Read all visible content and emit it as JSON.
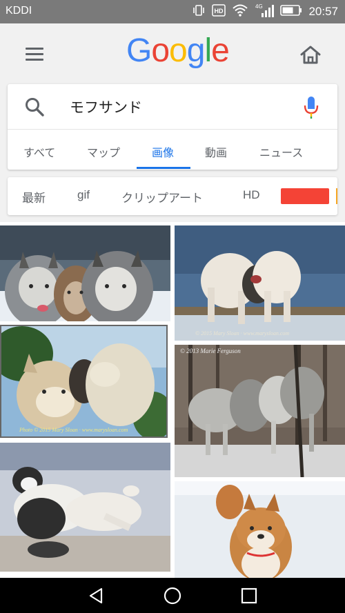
{
  "status_bar": {
    "carrier": "KDDI",
    "network": "4G",
    "time": "20:57",
    "icons": [
      "vibrate-icon",
      "hd-icon",
      "wifi-icon",
      "signal-icon",
      "battery-icon"
    ]
  },
  "header": {
    "logo_letters": [
      {
        "char": "G",
        "color": "#4285F4"
      },
      {
        "char": "o",
        "color": "#EA4335"
      },
      {
        "char": "o",
        "color": "#FBBC05"
      },
      {
        "char": "g",
        "color": "#4285F4"
      },
      {
        "char": "l",
        "color": "#34A853"
      },
      {
        "char": "e",
        "color": "#EA4335"
      }
    ],
    "icons": [
      "menu-icon",
      "home-icon"
    ]
  },
  "search": {
    "query": "モフサンド"
  },
  "tabs": {
    "all": "すべて",
    "maps": "マップ",
    "images": "画像",
    "videos": "動画",
    "news": "ニュース",
    "active": "画像"
  },
  "filters": {
    "latest": "最新",
    "gif": "gif",
    "clipart": "クリップアート",
    "hd": "HD",
    "color_chips": [
      "#f44336",
      "#f6a623"
    ]
  },
  "images": {
    "captions": {
      "tile2": "© 2015 Mary Sloan · www.marysloan.com",
      "tile3": "Photo © 2015 Mary Sloan · www.marysloan.com",
      "tile4": "© 2013 Marie Ferguson"
    }
  },
  "colors": {
    "accent": "#1a73e8",
    "status_bar": "#7a7a7a"
  }
}
